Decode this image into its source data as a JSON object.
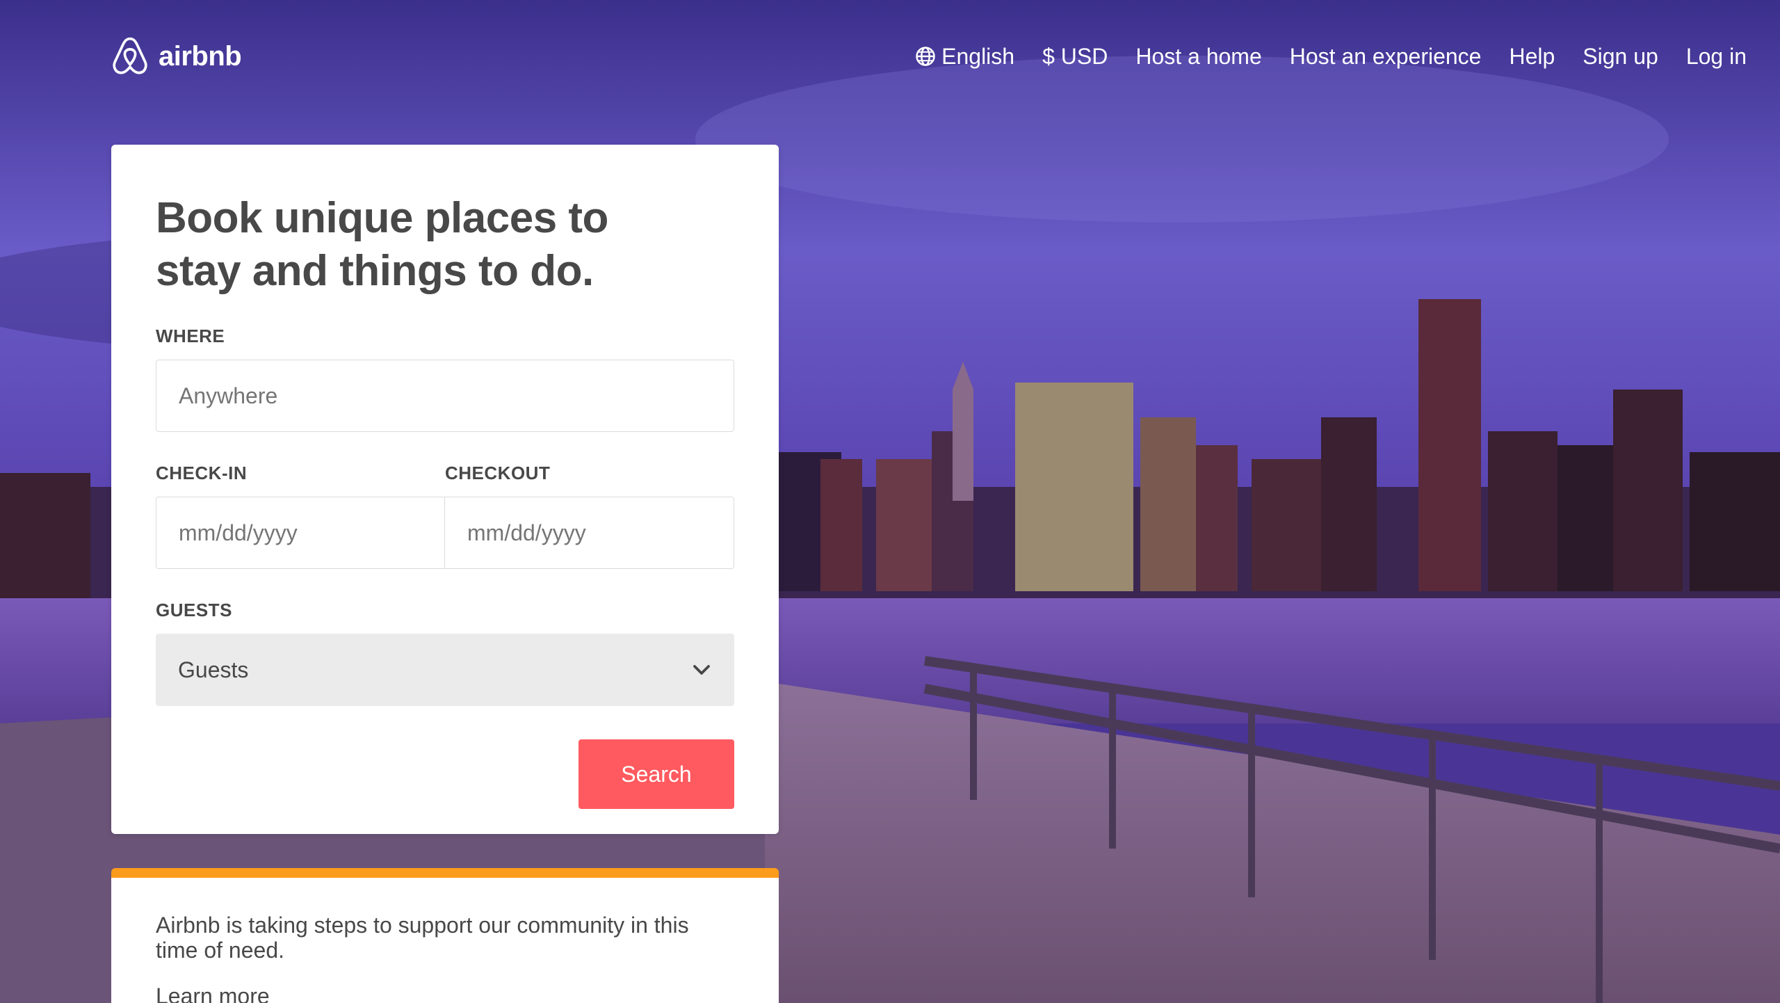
{
  "brand": {
    "name": "airbnb",
    "logo_icon": "airbnb-belo-icon"
  },
  "nav": {
    "items": [
      {
        "label": "English",
        "icon": "globe-icon"
      },
      {
        "label": "$ USD"
      },
      {
        "label": "Host a home"
      },
      {
        "label": "Host an experience"
      },
      {
        "label": "Help"
      },
      {
        "label": "Sign up"
      },
      {
        "label": "Log in"
      }
    ]
  },
  "booking": {
    "title": "Book unique places to stay and things to do.",
    "where": {
      "label": "WHERE",
      "placeholder": "Anywhere"
    },
    "checkin": {
      "label": "CHECK-IN",
      "placeholder": "mm/dd/yyyy"
    },
    "checkout": {
      "label": "CHECKOUT",
      "placeholder": "mm/dd/yyyy"
    },
    "guests": {
      "label": "GUESTS",
      "value": "Guests",
      "icon": "chevron-down-icon"
    },
    "search_label": "Search"
  },
  "notice": {
    "text": "Airbnb is taking steps to support our community in this time of need.",
    "link": "Learn more"
  },
  "colors": {
    "accent": "#ff5a5f",
    "notice_bar": "#fc9c1c",
    "text": "#484848"
  }
}
